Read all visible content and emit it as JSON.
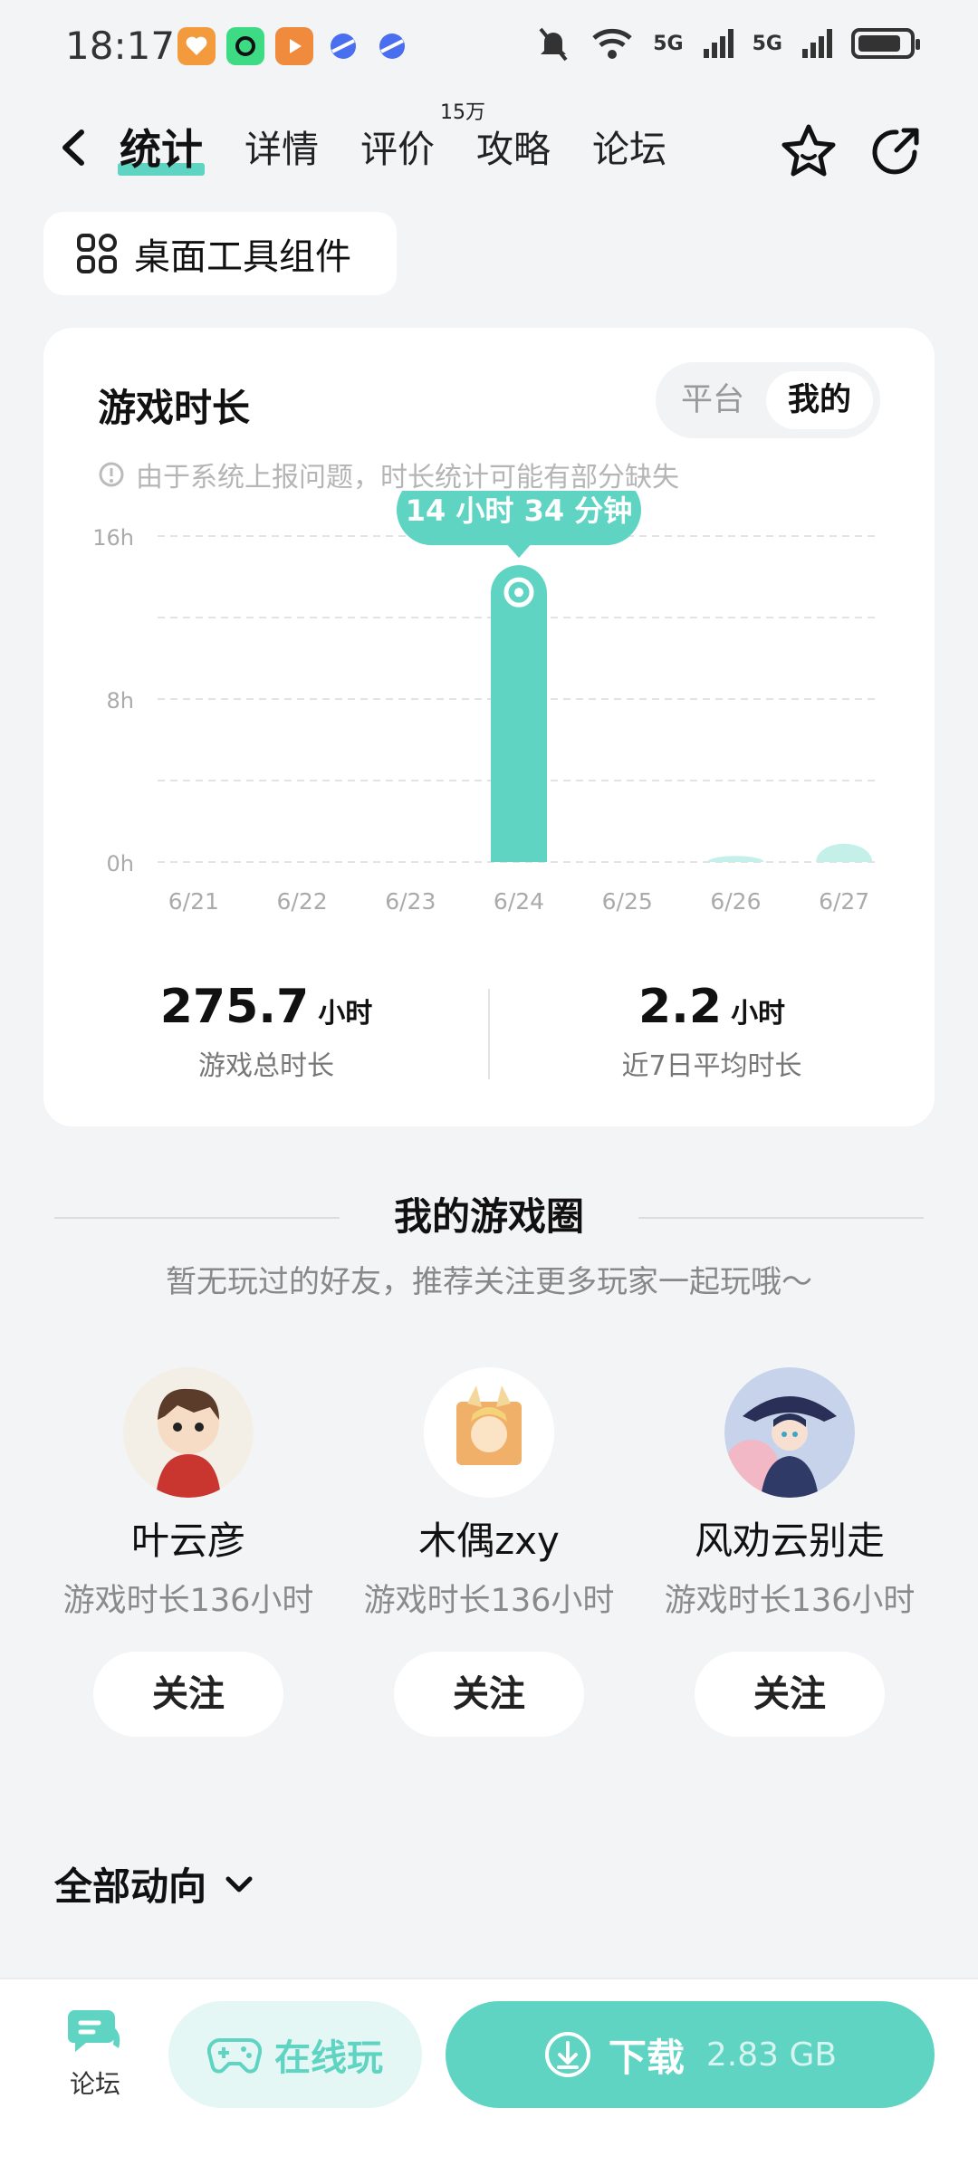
{
  "status_bar": {
    "time": "18:17",
    "signal_1": "5G",
    "signal_2": "5G"
  },
  "nav": {
    "tabs": [
      {
        "label": "统计"
      },
      {
        "label": "详情"
      },
      {
        "label": "评价",
        "badge": "15万"
      },
      {
        "label": "攻略"
      },
      {
        "label": "论坛"
      }
    ]
  },
  "widget_button": {
    "label": "桌面工具组件"
  },
  "playtime_card": {
    "title": "游戏时长",
    "toggle": [
      "平台",
      "我的"
    ],
    "notice": "由于系统上报问题，时长统计可能有部分缺失",
    "tooltip": "14 小时 34 分钟",
    "total": {
      "value": "275.7",
      "unit": "小时",
      "caption": "游戏总时长"
    },
    "average": {
      "value": "2.2",
      "unit": "小时",
      "caption": "近7日平均时长"
    }
  },
  "chart_data": {
    "type": "bar",
    "categories": [
      "6/21",
      "6/22",
      "6/23",
      "6/24",
      "6/25",
      "6/26",
      "6/27"
    ],
    "values": [
      0,
      0,
      0,
      14.57,
      0,
      0.3,
      0.9
    ],
    "ylim": [
      0,
      16
    ],
    "ytick_labels": [
      "0h",
      "8h",
      "16h"
    ],
    "grid": true,
    "highlight_index": 3,
    "color": "#5fd4c2",
    "dim_color": "#c4f0e9"
  },
  "game_circle": {
    "title": "我的游戏圈",
    "subtitle": "暂无玩过的好友，推荐关注更多玩家一起玩哦～",
    "friends": [
      {
        "name": "叶云彦",
        "playtime": "游戏时长136小时",
        "follow": "关注"
      },
      {
        "name": "木偶zxy",
        "playtime": "游戏时长136小时",
        "follow": "关注"
      },
      {
        "name": "风劝云别走",
        "playtime": "游戏时长136小时",
        "follow": "关注"
      }
    ]
  },
  "feed": {
    "title": "全部动向"
  },
  "bottom_bar": {
    "forum_label": "论坛",
    "online_play": "在线玩",
    "download": "下载",
    "download_size": "2.83 GB"
  }
}
